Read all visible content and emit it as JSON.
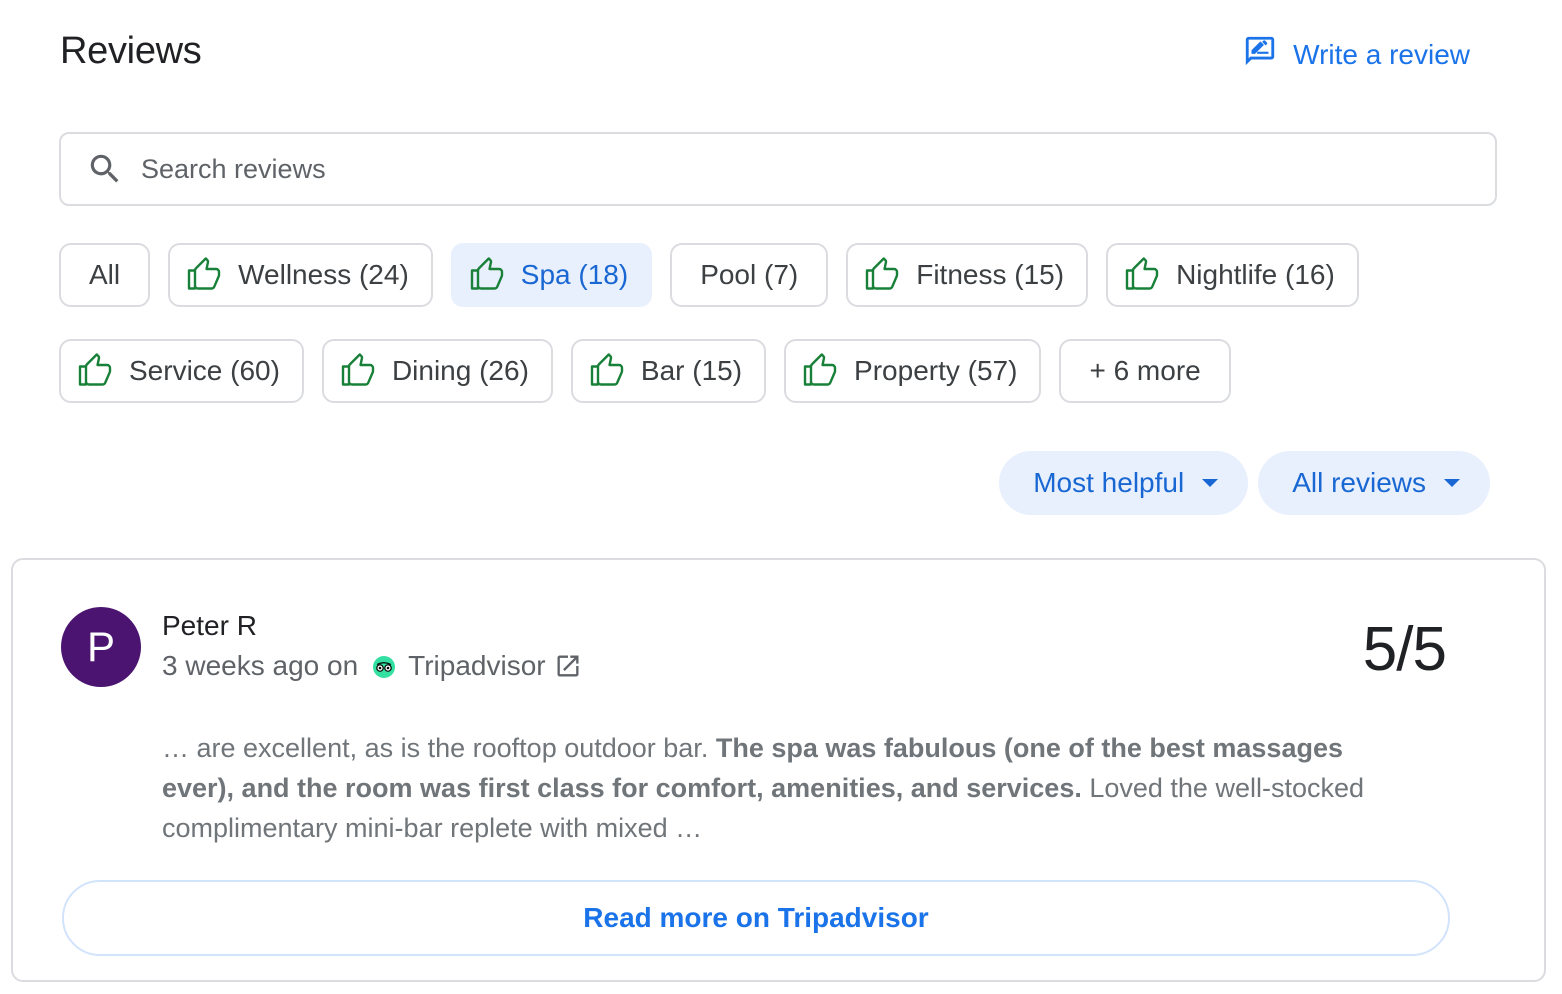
{
  "header": {
    "title": "Reviews",
    "write_review_label": "Write a review"
  },
  "search": {
    "placeholder": "Search reviews"
  },
  "filters": {
    "row1": [
      {
        "label": "All",
        "icon": null,
        "selected": false
      },
      {
        "label": "Wellness (24)",
        "icon": "thumbs-up-icon",
        "selected": false
      },
      {
        "label": "Spa (18)",
        "icon": "thumbs-up-icon",
        "selected": true
      },
      {
        "label": "Pool (7)",
        "icon": null,
        "selected": false
      },
      {
        "label": "Fitness (15)",
        "icon": "thumbs-up-icon",
        "selected": false
      },
      {
        "label": "Nightlife (16)",
        "icon": "thumbs-up-icon",
        "selected": false
      }
    ],
    "row2": [
      {
        "label": "Service (60)",
        "icon": "thumbs-up-icon",
        "selected": false
      },
      {
        "label": "Dining (26)",
        "icon": "thumbs-up-icon",
        "selected": false
      },
      {
        "label": "Bar (15)",
        "icon": "thumbs-up-icon",
        "selected": false
      },
      {
        "label": "Property (57)",
        "icon": "thumbs-up-icon",
        "selected": false
      },
      {
        "label": "+ 6 more",
        "icon": null,
        "selected": false
      }
    ]
  },
  "sort": {
    "order_label": "Most helpful",
    "source_label": "All reviews"
  },
  "review": {
    "avatar_letter": "P",
    "reviewer": "Peter R",
    "time": "3 weeks ago on",
    "source": "Tripadvisor",
    "score": "5/5",
    "text_before": "… are excellent, as is the rooftop outdoor bar. ",
    "text_bold": "The spa was fabulous (one of the best massages ever), and the room was first class for comfort, amenities, and services.",
    "text_after": " Loved the well-stocked complimentary mini-bar replete with mixed …",
    "read_more_label": "Read more on Tripadvisor"
  },
  "colors": {
    "accent": "#1a73e8",
    "chip_selected_bg": "#e8f0fe",
    "thumb_green": "#188038",
    "avatar_bg": "#4a1470",
    "tripadvisor_green": "#34e0a1"
  }
}
